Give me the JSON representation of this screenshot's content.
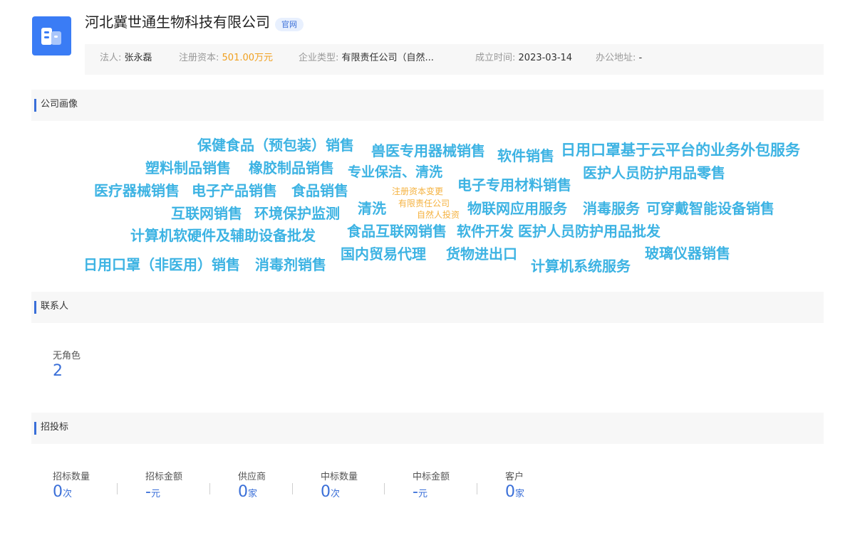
{
  "company": {
    "name": "河北冀世通生物科技有限公司",
    "official_tag": "官网",
    "logo_icon": "building-icon",
    "brand_color": "#3a7cf5"
  },
  "info": {
    "legal_person_label": "法人:",
    "legal_person_value": "张永磊",
    "capital_label": "注册资本:",
    "capital_value": "501.00万元",
    "type_label": "企业类型:",
    "type_value": "有限责任公司（自然...",
    "founded_label": "成立时间:",
    "founded_value": "2023-03-14",
    "address_label": "办公地址:",
    "address_value": "-"
  },
  "sections": {
    "portrait": "公司画像",
    "contacts": "联系人",
    "bidding": "招投标"
  },
  "wordcloud": {
    "words": [
      "保健食品（预包装）销售",
      "兽医专用器械销售",
      "软件销售",
      "日用口罩基于云平台的业务外包服务",
      "塑料制品销售",
      "橡胶制品销售",
      "专业保洁、清洗",
      "电子专用材料销售",
      "医护人员防护用品零售",
      "医疗器械销售",
      "电子产品销售",
      "食品销售",
      "互联网销售",
      "环境保护监测",
      "清洗",
      "物联网应用服务",
      "消毒服务",
      "可穿戴智能设备销售",
      "计算机软硬件及辅助设备批发",
      "食品互联网销售",
      "软件开发",
      "医护人员防护用品批发",
      "国内贸易代理",
      "货物进出口",
      "日用口罩（非医用）销售",
      "消毒剂销售",
      "计算机系统服务",
      "玻璃仪器销售"
    ],
    "tags": [
      "注册资本变更",
      "有限责任公司",
      "自然人投资"
    ],
    "word_color": "#3db3e3",
    "tag_color": "#f5b240"
  },
  "contacts": {
    "role_label": "无角色",
    "role_count": "2"
  },
  "bidding": {
    "items": [
      {
        "label": "招标数量",
        "value": "0",
        "unit": "次"
      },
      {
        "label": "招标金额",
        "value": "-",
        "unit": "元"
      },
      {
        "label": "供应商",
        "value": "0",
        "unit": "家"
      },
      {
        "label": "中标数量",
        "value": "0",
        "unit": "次"
      },
      {
        "label": "中标金额",
        "value": "-",
        "unit": "元"
      },
      {
        "label": "客户",
        "value": "0",
        "unit": "家"
      }
    ]
  },
  "accent_color": "#3a6fd8"
}
